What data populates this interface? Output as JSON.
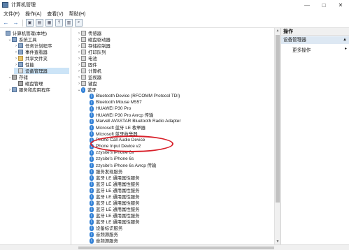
{
  "window": {
    "title": "计算机管理",
    "minimize": "—",
    "maximize": "□",
    "close": "✕"
  },
  "menu": [
    "文件(F)",
    "操作(A)",
    "查看(V)",
    "帮助(H)"
  ],
  "left_tree": [
    {
      "label": "计算机管理(本地)",
      "level": 0,
      "icon": "tool-icon",
      "expander": ""
    },
    {
      "label": "系统工具",
      "level": 1,
      "icon": "tool-icon",
      "expander": "⌄"
    },
    {
      "label": "任务计划程序",
      "level": 2,
      "icon": "tool-icon",
      "expander": "›"
    },
    {
      "label": "事件查看器",
      "level": 2,
      "icon": "tool-icon",
      "expander": "›"
    },
    {
      "label": "共享文件夹",
      "level": 2,
      "icon": "folder-icon",
      "expander": "›"
    },
    {
      "label": "性能",
      "level": 2,
      "icon": "tool-icon",
      "expander": "›"
    },
    {
      "label": "设备管理器",
      "level": 2,
      "icon": "device-icon",
      "expander": "",
      "selected": true
    },
    {
      "label": "存储",
      "level": 1,
      "icon": "disk-icon",
      "expander": "⌄"
    },
    {
      "label": "磁盘管理",
      "level": 2,
      "icon": "disk-icon",
      "expander": ""
    },
    {
      "label": "服务和应用程序",
      "level": 1,
      "icon": "tool-icon",
      "expander": "›"
    }
  ],
  "device_list": [
    {
      "label": "传感器",
      "level": 0,
      "icon": "device",
      "expander": "›"
    },
    {
      "label": "磁盘驱动器",
      "level": 0,
      "icon": "device",
      "expander": "›"
    },
    {
      "label": "存储控制器",
      "level": 0,
      "icon": "device",
      "expander": "›"
    },
    {
      "label": "打印队列",
      "level": 0,
      "icon": "device",
      "expander": "›"
    },
    {
      "label": "电池",
      "level": 0,
      "icon": "device",
      "expander": "›"
    },
    {
      "label": "固件",
      "level": 0,
      "icon": "device",
      "expander": "›"
    },
    {
      "label": "计算机",
      "level": 0,
      "icon": "device",
      "expander": "›"
    },
    {
      "label": "监视器",
      "level": 0,
      "icon": "device",
      "expander": "›"
    },
    {
      "label": "键盘",
      "level": 0,
      "icon": "device",
      "expander": "›"
    },
    {
      "label": "蓝牙",
      "level": 0,
      "icon": "bluetooth",
      "expander": "⌄"
    },
    {
      "label": "Bluetooth Device (RFCOMM Protocol TDI)",
      "level": 1,
      "icon": "bluetooth",
      "expander": ""
    },
    {
      "label": "Bluetooth Mouse M557",
      "level": 1,
      "icon": "bluetooth",
      "expander": ""
    },
    {
      "label": "HUAWEI P30 Pro",
      "level": 1,
      "icon": "bluetooth",
      "expander": ""
    },
    {
      "label": "HUAWEI P30 Pro Avrcp 传输",
      "level": 1,
      "icon": "bluetooth",
      "expander": ""
    },
    {
      "label": "Marvell AVASTAR Bluetooth Radio Adapter",
      "level": 1,
      "icon": "bluetooth",
      "expander": ""
    },
    {
      "label": "Microsoft 蓝牙 LE 枚举器",
      "level": 1,
      "icon": "bluetooth",
      "expander": ""
    },
    {
      "label": "Microsoft 蓝牙枚举器",
      "level": 1,
      "icon": "bluetooth",
      "expander": ""
    },
    {
      "label": "Phone Call Audio Device",
      "level": 1,
      "icon": "bluetooth",
      "expander": ""
    },
    {
      "label": "Phone Input Device v2",
      "level": 1,
      "icon": "bluetooth",
      "expander": ""
    },
    {
      "label": "zzysite's iPhone 6s",
      "level": 1,
      "icon": "bluetooth",
      "expander": ""
    },
    {
      "label": "zzysite's iPhone 6s",
      "level": 1,
      "icon": "bluetooth",
      "expander": ""
    },
    {
      "label": "zzysite's iPhone 6s Avrcp 传输",
      "level": 1,
      "icon": "bluetooth",
      "expander": ""
    },
    {
      "label": "服务发现服务",
      "level": 1,
      "icon": "bluetooth",
      "expander": ""
    },
    {
      "label": "蓝牙 LE 通用属性服务",
      "level": 1,
      "icon": "bluetooth",
      "expander": ""
    },
    {
      "label": "蓝牙 LE 通用属性服务",
      "level": 1,
      "icon": "bluetooth",
      "expander": ""
    },
    {
      "label": "蓝牙 LE 通用属性服务",
      "level": 1,
      "icon": "bluetooth",
      "expander": ""
    },
    {
      "label": "蓝牙 LE 通用属性服务",
      "level": 1,
      "icon": "bluetooth",
      "expander": ""
    },
    {
      "label": "蓝牙 LE 通用属性服务",
      "level": 1,
      "icon": "bluetooth",
      "expander": ""
    },
    {
      "label": "蓝牙 LE 通用属性服务",
      "level": 1,
      "icon": "bluetooth",
      "expander": ""
    },
    {
      "label": "蓝牙 LE 通用属性服务",
      "level": 1,
      "icon": "bluetooth",
      "expander": ""
    },
    {
      "label": "蓝牙 LE 通用属性服务",
      "level": 1,
      "icon": "bluetooth",
      "expander": ""
    },
    {
      "label": "设备标识服务",
      "level": 1,
      "icon": "bluetooth",
      "expander": ""
    },
    {
      "label": "音频源服务",
      "level": 1,
      "icon": "bluetooth",
      "expander": ""
    },
    {
      "label": "音频源服务",
      "level": 1,
      "icon": "bluetooth",
      "expander": ""
    }
  ],
  "actions": {
    "header": "操作",
    "section": "设备管理器",
    "more": "更多操作",
    "collapse_glyph": "▲",
    "more_glyph": "▸"
  },
  "colors": {
    "selection": "#cce4f7",
    "highlight_circle": "#d8202a",
    "bluetooth": "#2f7fd6"
  }
}
